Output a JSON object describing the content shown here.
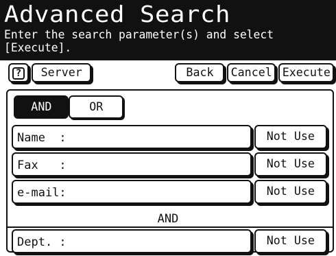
{
  "header": {
    "title": "Advanced Search",
    "subtitle": "Enter the search parameter(s) and select [Execute]."
  },
  "toolbar": {
    "help_icon": "?",
    "server_label": "Server",
    "back_label": "Back",
    "cancel_label": "Cancel",
    "execute_label": "Execute"
  },
  "logic": {
    "and_label": "AND",
    "or_label": "OR",
    "selected": "AND"
  },
  "fields": [
    {
      "label": "Name  :",
      "button": "Not Use"
    },
    {
      "label": "Fax   :",
      "button": "Not Use"
    },
    {
      "label": "e-mail:",
      "button": "Not Use"
    }
  ],
  "connector": "AND",
  "dept": {
    "label": "Dept. :",
    "button": "Not Use"
  },
  "colors": {
    "header_bg": "#111111",
    "header_text": "#ffffff",
    "selected_bg": "#111111"
  }
}
